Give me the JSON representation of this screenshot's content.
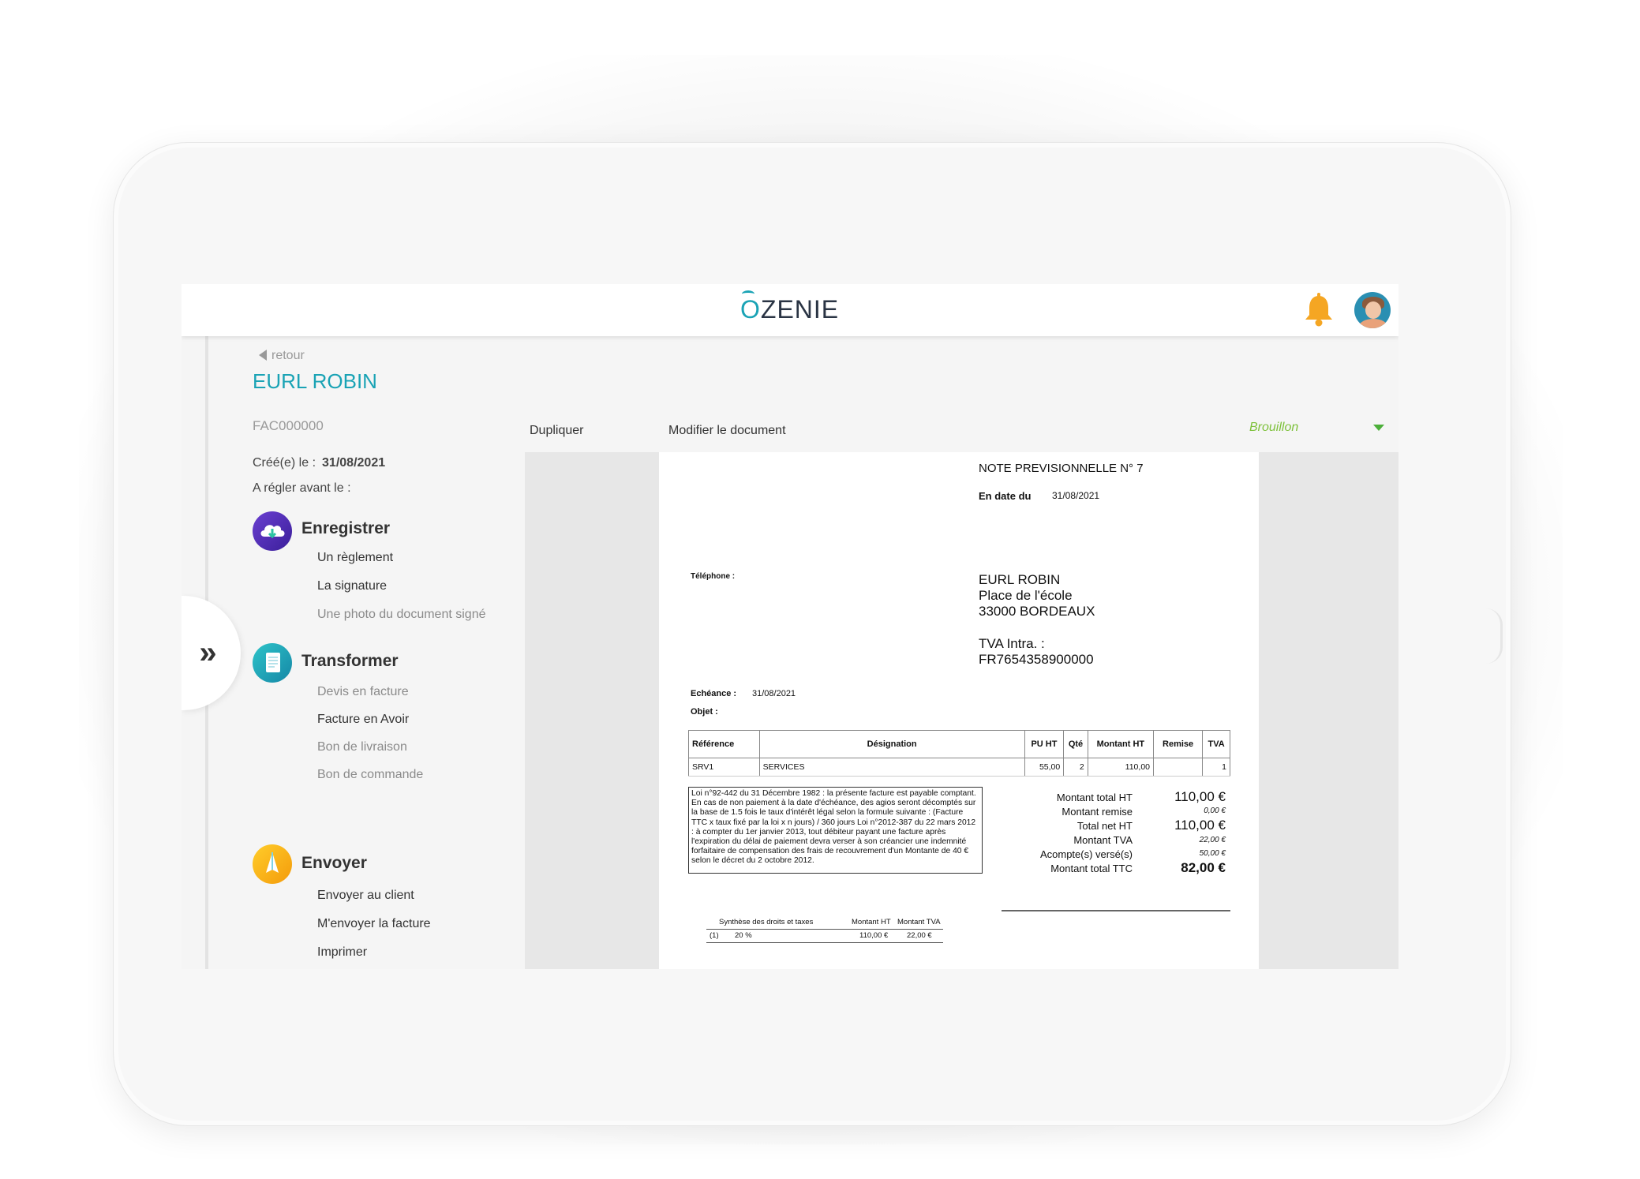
{
  "header": {
    "logo_o": "O",
    "logo_rest": "ZENIE"
  },
  "nav": {
    "back_label": "retour",
    "drawer_toggle": "»"
  },
  "document": {
    "client": "EURL ROBIN",
    "number": "FAC000000",
    "created_label": "Créé(e) le :",
    "created_value": "31/08/2021",
    "due_label": "A régler avant le :"
  },
  "sections": [
    {
      "title": "Enregistrer",
      "icon": "cloud-download-icon",
      "items": [
        "Un règlement",
        "La signature",
        "Une photo du document signé"
      ]
    },
    {
      "title": "Transformer",
      "icon": "document-icon",
      "items": [
        "Devis en facture",
        "Facture en Avoir",
        "Bon de livraison",
        "Bon de commande"
      ]
    },
    {
      "title": "Envoyer",
      "icon": "paper-plane-icon",
      "items": [
        "Envoyer au client",
        "M'envoyer la facture",
        "Imprimer"
      ]
    }
  ],
  "toolbar": {
    "duplicate": "Dupliquer",
    "edit": "Modifier le document",
    "status": "Brouillon"
  },
  "invoice": {
    "title": "NOTE PREVISIONNELLE  N° 7",
    "date_label": "En date du",
    "date_value": "31/08/2021",
    "phone_label": "Téléphone :",
    "addr_name": "EURL ROBIN",
    "addr_street": "Place de l'école",
    "addr_city": "33000   BORDEAUX",
    "tva_label": "TVA Intra. :",
    "tva_value": "FR7654358900000",
    "ech_label": "Echéance :",
    "ech_value": "31/08/2021",
    "obj_label": "Objet :",
    "columns": [
      "Référence",
      "Désignation",
      "PU HT",
      "Qté",
      "Montant HT",
      "Remise",
      "TVA"
    ],
    "rows": [
      [
        "SRV1",
        "SERVICES",
        "55,00",
        "2",
        "110,00",
        "",
        "1"
      ]
    ],
    "legal": "Loi n°92-442 du 31 Décembre 1982 : la présente facture est payable comptant. En cas de non paiement à la date d'échéance, des agios seront décomptés sur la base de 1.5 fois le taux d'intérêt légal selon la formule suivante :   (Facture TTC x taux fixé par la loi x n jours) / 360 jours Loi n°2012-387 du 22 mars 2012 : à compter du 1er janvier 2013, tout débiteur payant une facture après l'expiration du délai de paiement devra verser à son créancier une indemnité forfaitaire de compensation des frais de recouvrement d'un Montante de 40 € selon le décret du 2 octobre 2012.",
    "totals": [
      {
        "label": "Montant total HT",
        "value": "110,00 €"
      },
      {
        "label": "Montant remise",
        "value": "0,00 €"
      },
      {
        "label": "Total net HT",
        "value": "110,00 €"
      },
      {
        "label": "Montant TVA",
        "value": "22,00 €"
      },
      {
        "label": "Acompte(s) versé(s)",
        "value": "50,00 €"
      },
      {
        "label": "Montant total TTC",
        "value": "82,00 €"
      }
    ],
    "synthese": {
      "headers": [
        "Synthèse des droits et taxes",
        "Montant HT",
        "Montant TVA"
      ],
      "row": [
        "(1)",
        "20 %",
        "110,00 €",
        "22,00 €"
      ]
    }
  },
  "colors": {
    "accent": "#1aa3b5",
    "status": "#7ec13b",
    "bell": "#f5a623"
  }
}
